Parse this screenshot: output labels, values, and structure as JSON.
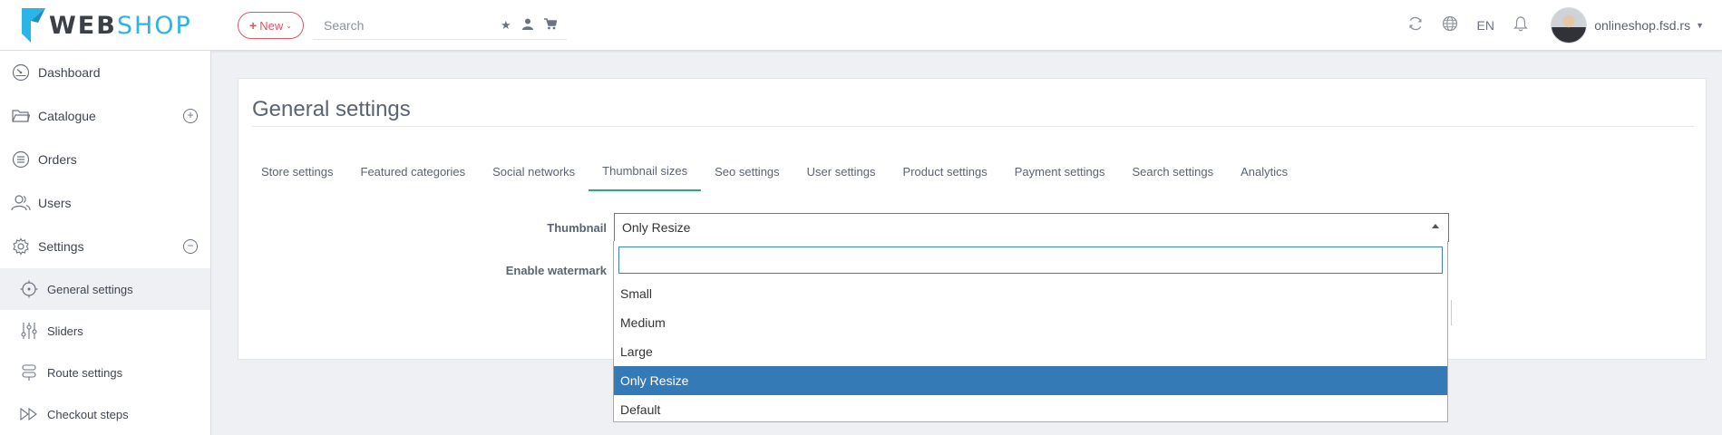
{
  "header": {
    "logo": {
      "web": "WEB",
      "shop": "SHOP"
    },
    "new_button": {
      "plus": "+",
      "label": "New",
      "chevron": "⌄"
    },
    "search": {
      "placeholder": "Search"
    },
    "search_icons": [
      "star-icon",
      "user-icon",
      "cart-icon"
    ],
    "language": "EN",
    "user_name": "onlineshop.fsd.rs",
    "colors": {
      "accent_red": "#e25563",
      "logo_blue": "#2ab4e8"
    }
  },
  "sidebar": {
    "items": [
      {
        "label": "Dashboard",
        "icon": "dashboard-icon"
      },
      {
        "label": "Catalogue",
        "icon": "folder-icon",
        "toggle": "+"
      },
      {
        "label": "Orders",
        "icon": "list-icon"
      },
      {
        "label": "Users",
        "icon": "users-icon"
      },
      {
        "label": "Settings",
        "icon": "gear-icon",
        "toggle": "−"
      }
    ],
    "sub_items": [
      {
        "label": "General settings",
        "icon": "target-icon",
        "active": true
      },
      {
        "label": "Sliders",
        "icon": "sliders-icon"
      },
      {
        "label": "Route settings",
        "icon": "route-icon"
      },
      {
        "label": "Checkout steps",
        "icon": "fast-forward-icon"
      }
    ]
  },
  "main": {
    "title": "General settings",
    "tabs": [
      {
        "label": "Store settings"
      },
      {
        "label": "Featured categories"
      },
      {
        "label": "Social networks"
      },
      {
        "label": "Thumbnail sizes",
        "active": true
      },
      {
        "label": "Seo settings"
      },
      {
        "label": "User settings"
      },
      {
        "label": "Product settings"
      },
      {
        "label": "Payment settings"
      },
      {
        "label": "Search settings"
      },
      {
        "label": "Analytics"
      }
    ],
    "form": {
      "thumbnail_label": "Thumbnail",
      "thumbnail_value": "Only Resize",
      "watermark_label": "Enable watermark"
    },
    "dropdown": {
      "search_value": "",
      "options": [
        "Small",
        "Medium",
        "Large",
        "Only Resize",
        "Default"
      ],
      "selected": "Only Resize",
      "selected_color": "#337ab7"
    },
    "active_tab_color": "#2aa882"
  }
}
